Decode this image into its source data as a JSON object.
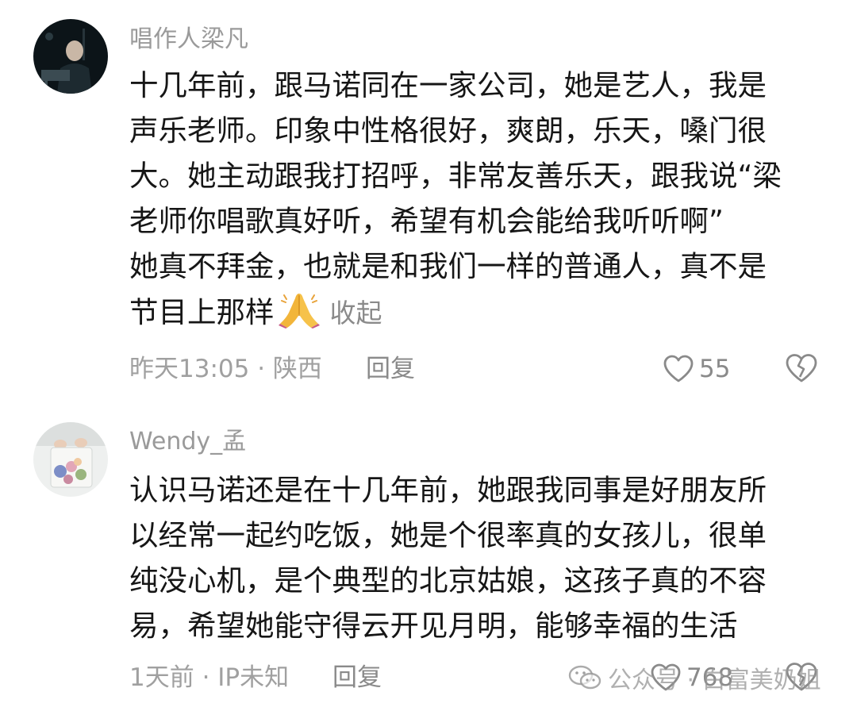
{
  "comments": [
    {
      "username": "唱作人梁凡",
      "lines": [
        "十几年前，跟马诺同在一家公司，她是艺人，我是",
        "声乐老师。印象中性格很好，爽朗，乐天，嗓门很",
        "大。她主动跟我打招呼，非常友善乐天，跟我说“梁",
        "老师你唱歌真好听，希望有机会能给我听听啊”",
        "她真不拜金，也就是和我们一样的普通人，真不是"
      ],
      "last_line": "节目上那样",
      "emoji": "folded-hands-icon",
      "collapse_label": "收起",
      "time_location": "昨天13:05 · 陕西",
      "reply_label": "回复",
      "like_count": "55"
    },
    {
      "username": "Wendy_孟",
      "lines": [
        "认识马诺还是在十几年前，她跟我同事是好朋友所",
        "以经常一起约吃饭，她是个很率真的女孩儿，很单",
        "纯没心机，是个典型的北京姑娘，这孩子真的不容",
        "易，希望她能守得云开见月明，能够幸福的生活"
      ],
      "time_location": "1天前 · IP未知",
      "reply_label": "回复",
      "like_count": "768"
    }
  ],
  "watermark": {
    "text": "公众号 · 白富美奶姐",
    "icon": "wechat-icon"
  },
  "colors": {
    "text": "#161616",
    "meta": "#a0a0a0",
    "username": "#9a9a9a",
    "emoji": "#f2b53a"
  }
}
